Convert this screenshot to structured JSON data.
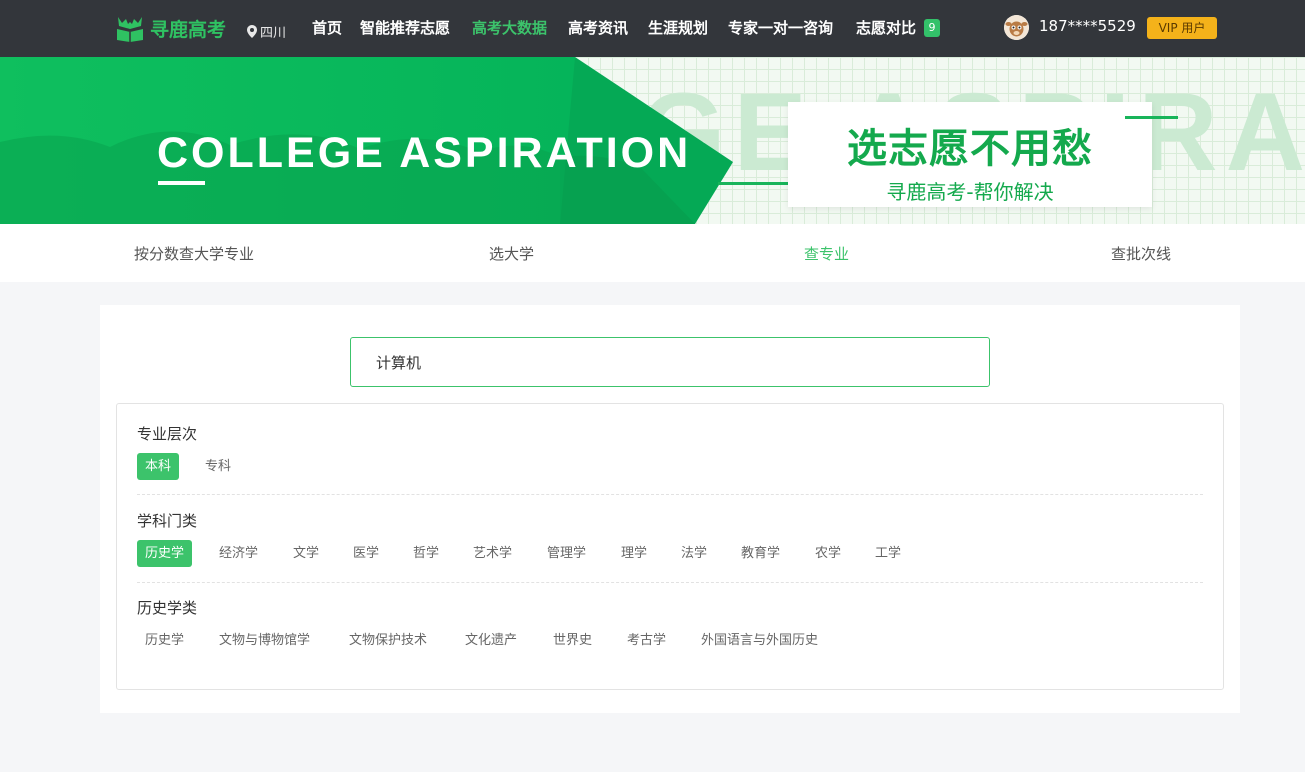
{
  "nav": {
    "brand": "寻鹿高考",
    "location": "四川",
    "items": [
      {
        "label": "首页"
      },
      {
        "label": "智能推荐志愿"
      },
      {
        "label": "高考大数据"
      },
      {
        "label": "高考资讯"
      },
      {
        "label": "生涯规划"
      },
      {
        "label": "专家一对一咨询"
      },
      {
        "label": "志愿对比"
      }
    ],
    "active_item": "高考大数据",
    "compare_count": "9",
    "phone": "187****5529",
    "vip_label": "VIP 用户"
  },
  "banner": {
    "title": "COLLEGE ASPIRATION",
    "watermark": "GE ASPIRAT",
    "slogan_main": "选志愿不用愁",
    "slogan_sub": "寻鹿高考-帮你解决"
  },
  "tabs": [
    {
      "label": "按分数查大学专业"
    },
    {
      "label": "选大学"
    },
    {
      "label": "查专业"
    },
    {
      "label": "查批次线"
    }
  ],
  "active_tab": "查专业",
  "search": {
    "value": "计算机"
  },
  "filters": {
    "level": {
      "title": "专业层次",
      "options": [
        "本科",
        "专科"
      ],
      "selected": "本科"
    },
    "discipline": {
      "title": "学科门类",
      "options": [
        "历史学",
        "经济学",
        "文学",
        "医学",
        "哲学",
        "艺术学",
        "管理学",
        "理学",
        "法学",
        "教育学",
        "农学",
        "工学"
      ],
      "selected": "历史学"
    },
    "category": {
      "title": "历史学类",
      "options": [
        "历史学",
        "文物与博物馆学",
        "文物保护技术",
        "文化遗产",
        "世界史",
        "考古学",
        "外国语言与外国历史"
      ]
    }
  },
  "colors": {
    "accent": "#3cc36b",
    "nav_bg": "#33363b",
    "vip": "#f4b21a"
  }
}
